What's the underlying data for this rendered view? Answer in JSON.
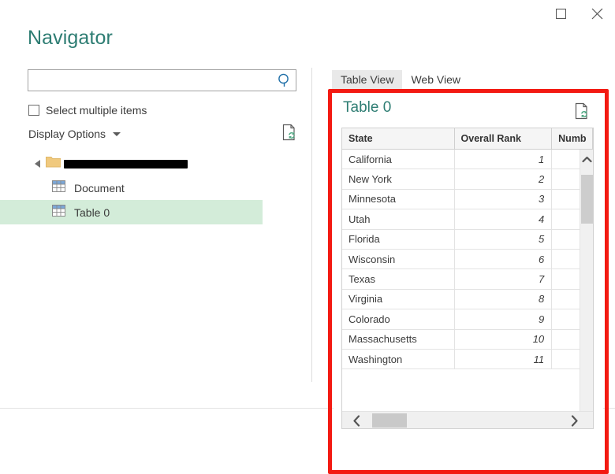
{
  "window": {
    "maximize_icon": "maximize-icon",
    "close_icon": "close-icon"
  },
  "dialog": {
    "title": "Navigator"
  },
  "search": {
    "value": "",
    "placeholder": "",
    "icon": "search-icon"
  },
  "options": {
    "select_multiple_label": "Select multiple items",
    "select_multiple_checked": false,
    "display_options_label": "Display Options",
    "dropdown_icon": "chevron-down-icon",
    "refresh_icon": "page-refresh-icon"
  },
  "tree": {
    "root": {
      "label": "",
      "redacted": true,
      "expander_icon": "expander-collapsed-icon",
      "icon": "folder-icon"
    },
    "items": [
      {
        "label": "Document",
        "icon": "table-grid-icon",
        "selected": false
      },
      {
        "label": "Table 0",
        "icon": "table-grid-icon",
        "selected": true
      }
    ]
  },
  "preview": {
    "tabs": [
      {
        "label": "Table View",
        "active": true
      },
      {
        "label": "Web View",
        "active": false
      }
    ],
    "table_title": "Table 0",
    "refresh_icon": "page-refresh-icon",
    "columns": [
      "State",
      "Overall Rank",
      "Numb"
    ],
    "rows": [
      [
        "California",
        "1",
        ""
      ],
      [
        "New York",
        "2",
        ""
      ],
      [
        "Minnesota",
        "3",
        ""
      ],
      [
        "Utah",
        "4",
        ""
      ],
      [
        "Florida",
        "5",
        ""
      ],
      [
        "Wisconsin",
        "6",
        ""
      ],
      [
        "Texas",
        "7",
        ""
      ],
      [
        "Virginia",
        "8",
        ""
      ],
      [
        "Colorado",
        "9",
        ""
      ],
      [
        "Massachusetts",
        "10",
        ""
      ],
      [
        "Washington",
        "11",
        ""
      ]
    ],
    "vscroll": {
      "up_icon": "scroll-up-icon",
      "down_icon": "scroll-down-icon"
    },
    "hscroll": {
      "left_icon": "scroll-left-icon",
      "right_icon": "scroll-right-icon"
    }
  },
  "annotation": {
    "highlight_color": "#f31a12"
  }
}
